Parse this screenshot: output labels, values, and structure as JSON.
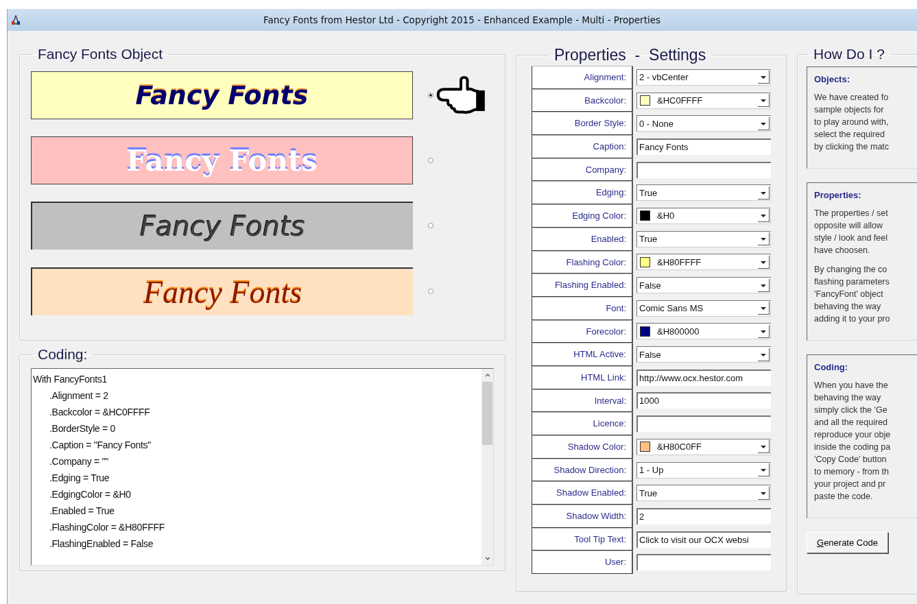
{
  "window": {
    "title": "Fancy Fonts from Hestor Ltd - Copyright 2015 - Enhanced Example - Multi - Properties"
  },
  "object_panel": {
    "title": "Fancy Fonts Object",
    "samples": [
      {
        "caption": "Fancy Fonts",
        "kind": "comic",
        "selected": true
      },
      {
        "caption": "Fancy Fonts",
        "kind": "serif-shadow",
        "selected": false
      },
      {
        "caption": "Fancy Fonts",
        "kind": "edged-gray",
        "selected": false
      },
      {
        "caption": "Fancy Fonts",
        "kind": "script",
        "selected": false
      }
    ]
  },
  "coding_panel": {
    "title": "Coding:",
    "lines": [
      {
        "text": "With FancyFonts1",
        "indented": false
      },
      {
        "text": ".Alignment = 2",
        "indented": true
      },
      {
        "text": ".Backcolor = &HC0FFFF",
        "indented": true
      },
      {
        "text": ".BorderStyle = 0",
        "indented": true
      },
      {
        "text": ".Caption = \"Fancy Fonts\"",
        "indented": true
      },
      {
        "text": ".Company  = \"\"",
        "indented": true
      },
      {
        "text": ".Edging = True",
        "indented": true
      },
      {
        "text": ".EdgingColor = &H0",
        "indented": true
      },
      {
        "text": ".Enabled = True",
        "indented": true
      },
      {
        "text": ".FlashingColor = &H80FFFF",
        "indented": true
      },
      {
        "text": ".FlashingEnabled = False",
        "indented": true
      }
    ]
  },
  "properties_panel": {
    "title": "Properties  -  Settings",
    "rows": [
      {
        "label": "Alignment:",
        "kind": "dropdown",
        "value": "2 - vbCenter"
      },
      {
        "label": "Backcolor:",
        "kind": "color",
        "value": "&HC0FFFF",
        "color": "#ffffc0"
      },
      {
        "label": "Border Style:",
        "kind": "dropdown",
        "value": "0 - None"
      },
      {
        "label": "Caption:",
        "kind": "text",
        "value": "Fancy Fonts"
      },
      {
        "label": "Company:",
        "kind": "text"
      },
      {
        "label": "Edging:",
        "kind": "dropdown",
        "value": "True"
      },
      {
        "label": "Edging Color:",
        "kind": "color",
        "value": "&H0",
        "color": "#000000"
      },
      {
        "label": "Enabled:",
        "kind": "dropdown",
        "value": "True"
      },
      {
        "label": "Flashing Color:",
        "kind": "color",
        "value": "&H80FFFF",
        "color": "#ffff80"
      },
      {
        "label": "Flashing Enabled:",
        "kind": "dropdown",
        "value": "False"
      },
      {
        "label": "Font:",
        "kind": "dropdown",
        "value": "Comic Sans MS"
      },
      {
        "label": "Forecolor:",
        "kind": "color",
        "value": "&H800000",
        "color": "#000080"
      },
      {
        "label": "HTML Active:",
        "kind": "dropdown",
        "value": "False"
      },
      {
        "label": "HTML Link:",
        "kind": "text",
        "value": "http://www.ocx.hestor.com"
      },
      {
        "label": "Interval:",
        "kind": "text",
        "value": "1000"
      },
      {
        "label": "Licence:",
        "kind": "text"
      },
      {
        "label": "Shadow Color:",
        "kind": "color",
        "value": "&H80C0FF",
        "color": "#ffc080"
      },
      {
        "label": "Shadow Direction:",
        "kind": "dropdown",
        "value": "1 - Up"
      },
      {
        "label": "Shadow Enabled:",
        "kind": "dropdown",
        "value": "True"
      },
      {
        "label": "Shadow Width:",
        "kind": "text",
        "value": "2"
      },
      {
        "label": "Tool Tip Text:",
        "kind": "text",
        "value": "Click to visit our OCX websi"
      },
      {
        "label": "User:",
        "kind": "text"
      }
    ]
  },
  "help_panel": {
    "title": "How Do I ?",
    "sections": [
      {
        "heading": "Objects:",
        "paragraphs": [
          [
            "We have created fo",
            "sample objects for",
            "to play around with,",
            "select the required",
            "by clicking the matc"
          ]
        ]
      },
      {
        "heading": "Properties:",
        "paragraphs": [
          [
            "The properties / set",
            "opposite will allow",
            "style / look and feel",
            "have choosen."
          ],
          [
            "By changing the co",
            "flashing parameters",
            "'FancyFont' object",
            "behaving the way",
            "adding it to your pro"
          ]
        ]
      },
      {
        "heading": "Coding:",
        "paragraphs": [
          [
            "When you have the",
            "behaving the way",
            "simply click the 'Ge",
            "and all the required",
            "reproduce your obje",
            "inside the coding pa",
            "'Copy Code' button",
            "to memory - from th",
            "your project and pr",
            "paste the code."
          ]
        ]
      }
    ],
    "button": "Generate Code"
  }
}
